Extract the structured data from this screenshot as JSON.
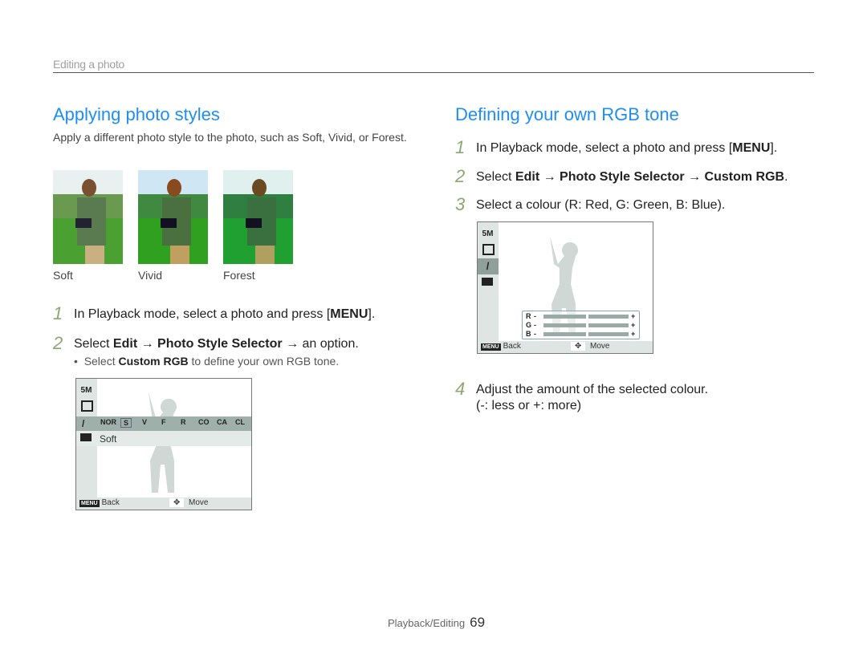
{
  "header": {
    "section": "Editing a photo"
  },
  "left": {
    "title": "Applying photo styles",
    "intro": "Apply a different photo style to the photo, such as Soft, Vivid, or Forest.",
    "thumbnails": [
      {
        "caption": "Soft",
        "tone": "soft"
      },
      {
        "caption": "Vivid",
        "tone": "vivid"
      },
      {
        "caption": "Forest",
        "tone": "forest"
      }
    ],
    "steps": [
      {
        "num": "1",
        "text_pre": "In Playback mode, select a photo and press [",
        "bold": "MENU",
        "text_post": "]."
      },
      {
        "num": "2",
        "text_pre": "Select ",
        "bold1": "Edit",
        "arrow": " → ",
        "bold2": "Photo Style Selector",
        "text_post": " → an option."
      }
    ],
    "bullet": {
      "pre": "Select ",
      "bold": "Custom RGB",
      "post": " to define your own RGB tone."
    },
    "screen": {
      "side_icons": [
        "5M",
        "rotate-icon",
        "photo-style-icon",
        "custom-rgb-icon"
      ],
      "style_options": [
        "NOR",
        "S",
        "V",
        "F",
        "R",
        "CO",
        "CA",
        "CL"
      ],
      "selected_style": "S",
      "selected_label": "Soft",
      "back_key": "MENU",
      "back_label": "Back",
      "move_label": "Move"
    }
  },
  "right": {
    "title": "Defining your own RGB tone",
    "steps": [
      {
        "num": "1",
        "text_pre": "In Playback mode, select a photo and press [",
        "bold": "MENU",
        "text_post": "]."
      },
      {
        "num": "2",
        "text_pre": "Select ",
        "bold1": "Edit",
        "bold2": "Photo Style Selector",
        "bold3": "Custom RGB",
        "text_post": "."
      },
      {
        "num": "3",
        "text": "Select a colour (R: Red, G: Green, B: Blue)."
      },
      {
        "num": "4",
        "text": "Adjust the amount of the selected colour.",
        "text2": "(-: less or +: more)"
      }
    ],
    "screen": {
      "side_icons": [
        "5M",
        "rotate-icon",
        "photo-style-icon",
        "custom-rgb-icon"
      ],
      "rgb": [
        {
          "label": "R",
          "minus": "-",
          "plus": "+",
          "level": 0.5
        },
        {
          "label": "G",
          "minus": "-",
          "plus": "+",
          "level": 0.5
        },
        {
          "label": "B",
          "minus": "-",
          "plus": "+",
          "level": 0.5
        }
      ],
      "back_key": "MENU",
      "back_label": "Back",
      "move_label": "Move"
    }
  },
  "footer": {
    "section": "Playback/Editing",
    "page": "69"
  },
  "colors": {
    "heading": "#1e8ef0",
    "step_number": "#8aa870"
  }
}
